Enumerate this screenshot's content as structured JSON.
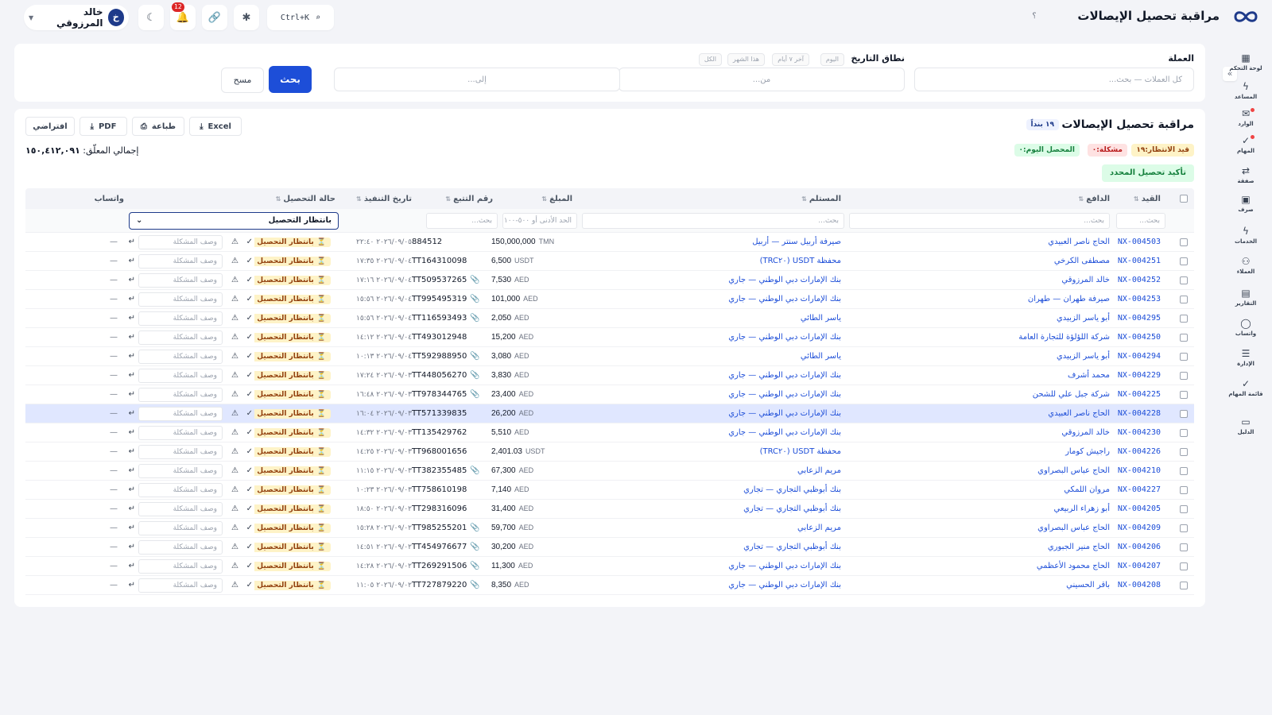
{
  "header": {
    "title": "مراقبة تحصيل الإيصالات",
    "help": "؟",
    "user_name": "خالد المرزوقي",
    "user_initial": "خ",
    "notif_count": "12",
    "search_shortcut": "Ctrl+K"
  },
  "sidebar": {
    "items": [
      {
        "label": "لوحة التحكم",
        "icon": "dashboard-icon",
        "glyph": "▦"
      },
      {
        "label": "المساعد",
        "icon": "bolt-icon",
        "glyph": "ϟ"
      },
      {
        "label": "الوارد",
        "icon": "inbox-icon",
        "glyph": "✉"
      },
      {
        "label": "المهام",
        "icon": "tasks-icon",
        "glyph": "✓"
      },
      {
        "label": "صفقة",
        "icon": "exchange-icon",
        "glyph": "⇄"
      },
      {
        "label": "صرف",
        "icon": "cash-icon",
        "glyph": "▣"
      },
      {
        "label": "الخدمات",
        "icon": "services-icon",
        "glyph": "ϟ"
      },
      {
        "label": "العملاء",
        "icon": "clients-icon",
        "glyph": "⚇"
      },
      {
        "label": "التقارير",
        "icon": "reports-icon",
        "glyph": "▤"
      },
      {
        "label": "واتساب",
        "icon": "whatsapp-icon",
        "glyph": "◯"
      },
      {
        "label": "الإدارة",
        "icon": "admin-icon",
        "glyph": "☰"
      },
      {
        "label": "قائمة المهام",
        "icon": "checklist-icon",
        "glyph": "✓"
      },
      {
        "label": "الدليل",
        "icon": "guide-icon",
        "glyph": "▭"
      }
    ]
  },
  "filters": {
    "currency_label": "العملة",
    "currency_placeholder": "كل العملات — بحث...",
    "date_range_label": "نطاق التاريخ",
    "ranges": [
      "اليوم",
      "آخر ٧ أيام",
      "هذا الشهر",
      "الكل"
    ],
    "from_placeholder": "من...",
    "to_placeholder": "إلى...",
    "search_btn": "بحث",
    "clear_btn": "مسح"
  },
  "main": {
    "title": "مراقبة تحصيل الإيصالات",
    "count_badge": "١٩ بنداً",
    "stats": {
      "pending": "قيد الانتظار:١٩",
      "issue": "مشكلة:٠",
      "collected_today": "المحصل اليوم:٠"
    },
    "confirm_btn": "تأكيد تحصيل المحدد",
    "total_label": "إجمالي المعلّق:",
    "total_value": "١٥٠,٤١٢,٠٩١",
    "export": {
      "excel": "Excel",
      "print": "طباعة",
      "pdf": "PDF",
      "default": "افتراضي"
    }
  },
  "table": {
    "headers": {
      "ref": "القيد",
      "payer": "الدافع",
      "recipient": "المستلم",
      "amount": "المبلغ",
      "tracking": "رقم التتبع",
      "exec_date": "تاريخ التنفيذ",
      "status": "حالة التحصيل",
      "whatsapp": "واتساب"
    },
    "filter_placeholders": {
      "search": "بحث...",
      "amount_range": "الحد الأدنى أو ٥٠٠-١٠٠"
    },
    "status_filter": "بانتظار التحصيل",
    "status_pill": "بانتظار التحصيل",
    "issue_placeholder": "وصف المشكلة",
    "rows": [
      {
        "ref": "NX-004503",
        "payer": "الحاج ناصر العبيدي",
        "recipient": "صيرفة أربيل سنتر — أربيل",
        "amount": "150,000,000",
        "currency": "TMN",
        "tracking": "884512",
        "attach": "",
        "date": "٢٠٢٦/٠٩/٠٥ ٢٢:٤٠",
        "wa": "—"
      },
      {
        "ref": "NX-004251",
        "payer": "مصطفى الكرخي",
        "recipient": "محفظة USDT (TRC٢٠)",
        "amount": "6,500",
        "currency": "USDT",
        "tracking": "TT164310098",
        "attach": "",
        "date": "٢٠٢٦/٠٩/٠٤ ١٧:٣٥",
        "wa": "—"
      },
      {
        "ref": "NX-004252",
        "payer": "خالد المرزوقي",
        "recipient": "بنك الإمارات دبي الوطني — جاري",
        "amount": "7,530",
        "currency": "AED",
        "tracking": "TT509537265",
        "attach": "📎",
        "date": "٢٠٢٦/٠٩/٠٤ ١٧:١٦",
        "wa": "—"
      },
      {
        "ref": "NX-004253",
        "payer": "صيرفة طهران — طهران",
        "recipient": "بنك الإمارات دبي الوطني — جاري",
        "amount": "101,000",
        "currency": "AED",
        "tracking": "TT995495319",
        "attach": "📎",
        "date": "٢٠٢٦/٠٩/٠٤ ١٥:٥٦",
        "wa": "—"
      },
      {
        "ref": "NX-004295",
        "payer": "أبو ياسر الزبيدي",
        "recipient": "ياسر الطائي",
        "amount": "2,050",
        "currency": "AED",
        "tracking": "TT116593493",
        "attach": "📎",
        "date": "٢٠٢٦/٠٩/٠٤ ١٥:٥٦",
        "wa": "—"
      },
      {
        "ref": "NX-004250",
        "payer": "شركة اللؤلؤة للتجارة العامة",
        "recipient": "بنك الإمارات دبي الوطني — جاري",
        "amount": "15,200",
        "currency": "AED",
        "tracking": "TT493012948",
        "attach": "",
        "date": "٢٠٢٦/٠٩/٠٤ ١٤:١٢",
        "wa": "—"
      },
      {
        "ref": "NX-004294",
        "payer": "أبو ياسر الزبيدي",
        "recipient": "ياسر الطائي",
        "amount": "3,080",
        "currency": "AED",
        "tracking": "TT592988950",
        "attach": "📎",
        "date": "٢٠٢٦/٠٩/٠٤ ١٠:١٣",
        "wa": "—"
      },
      {
        "ref": "NX-004229",
        "payer": "محمد أشرف",
        "recipient": "بنك الإمارات دبي الوطني — جاري",
        "amount": "3,830",
        "currency": "AED",
        "tracking": "TT448056270",
        "attach": "📎",
        "date": "٢٠٢٦/٠٩/٠٣ ١٧:٢٤",
        "wa": "—"
      },
      {
        "ref": "NX-004225",
        "payer": "شركة جبل علي للشحن",
        "recipient": "بنك الإمارات دبي الوطني — جاري",
        "amount": "23,400",
        "currency": "AED",
        "tracking": "TT978344765",
        "attach": "📎",
        "date": "٢٠٢٦/٠٩/٠٣ ١٦:٤٨",
        "wa": "—"
      },
      {
        "ref": "NX-004228",
        "payer": "الحاج ناصر العبيدي",
        "recipient": "بنك الإمارات دبي الوطني — جاري",
        "amount": "26,200",
        "currency": "AED",
        "tracking": "TT571339835",
        "attach": "",
        "date": "٢٠٢٦/٠٩/٠٣ ١٦:٠٤",
        "wa": "—",
        "selected": true
      },
      {
        "ref": "NX-004230",
        "payer": "خالد المرزوقي",
        "recipient": "بنك الإمارات دبي الوطني — جاري",
        "amount": "5,510",
        "currency": "AED",
        "tracking": "TT135429762",
        "attach": "",
        "date": "٢٠٢٦/٠٩/٠٣ ١٤:٣٢",
        "wa": "—"
      },
      {
        "ref": "NX-004226",
        "payer": "راجيش كومار",
        "recipient": "محفظة USDT (TRC٢٠)",
        "amount": "2,401.03",
        "currency": "USDT",
        "tracking": "TT968001656",
        "attach": "",
        "date": "٢٠٢٦/٠٩/٠٣ ١٤:٢٥",
        "wa": "—"
      },
      {
        "ref": "NX-004210",
        "payer": "الحاج عباس البصراوي",
        "recipient": "مريم الزعابي",
        "amount": "67,300",
        "currency": "AED",
        "tracking": "TT382355485",
        "attach": "📎",
        "date": "٢٠٢٦/٠٩/٠٣ ١١:١٥",
        "wa": "—"
      },
      {
        "ref": "NX-004227",
        "payer": "مروان اللمكي",
        "recipient": "بنك أبوظبي التجاري — تجاري",
        "amount": "7,140",
        "currency": "AED",
        "tracking": "TT758610198",
        "attach": "",
        "date": "٢٠٢٦/٠٩/٠٣ ١٠:٢٣",
        "wa": "—"
      },
      {
        "ref": "NX-004205",
        "payer": "أبو زهراء الربيعي",
        "recipient": "بنك أبوظبي التجاري — تجاري",
        "amount": "31,400",
        "currency": "AED",
        "tracking": "TT298316096",
        "attach": "",
        "date": "٢٠٢٦/٠٩/٠٢ ١٨:٥٠",
        "wa": "—"
      },
      {
        "ref": "NX-004209",
        "payer": "الحاج عباس البصراوي",
        "recipient": "مريم الزعابي",
        "amount": "59,700",
        "currency": "AED",
        "tracking": "TT985255201",
        "attach": "📎",
        "date": "٢٠٢٦/٠٩/٠٢ ١٥:٢٨",
        "wa": "—"
      },
      {
        "ref": "NX-004206",
        "payer": "الحاج منير الجبوري",
        "recipient": "بنك أبوظبي التجاري — تجاري",
        "amount": "30,200",
        "currency": "AED",
        "tracking": "TT454976677",
        "attach": "📎",
        "date": "٢٠٢٦/٠٩/٠٢ ١٤:٥١",
        "wa": "—"
      },
      {
        "ref": "NX-004207",
        "payer": "الحاج محمود الأعظمي",
        "recipient": "بنك الإمارات دبي الوطني — جاري",
        "amount": "11,300",
        "currency": "AED",
        "tracking": "TT269291506",
        "attach": "📎",
        "date": "٢٠٢٦/٠٩/٠٢ ١٤:٢٨",
        "wa": "—"
      },
      {
        "ref": "NX-004208",
        "payer": "باقر الحسيني",
        "recipient": "بنك الإمارات دبي الوطني — جاري",
        "amount": "8,350",
        "currency": "AED",
        "tracking": "TT727879220",
        "attach": "📎",
        "date": "٢٠٢٦/٠٩/٠٢ ١١:٠٥",
        "wa": "—"
      }
    ]
  },
  "colors": {
    "accent": "#1d4ed8",
    "brand": "#1e3a8a",
    "pending_bg": "#fef3c7",
    "issue_bg": "#fee2e2",
    "success_bg": "#dcfce7",
    "selected_row": "#e0e7ff"
  }
}
